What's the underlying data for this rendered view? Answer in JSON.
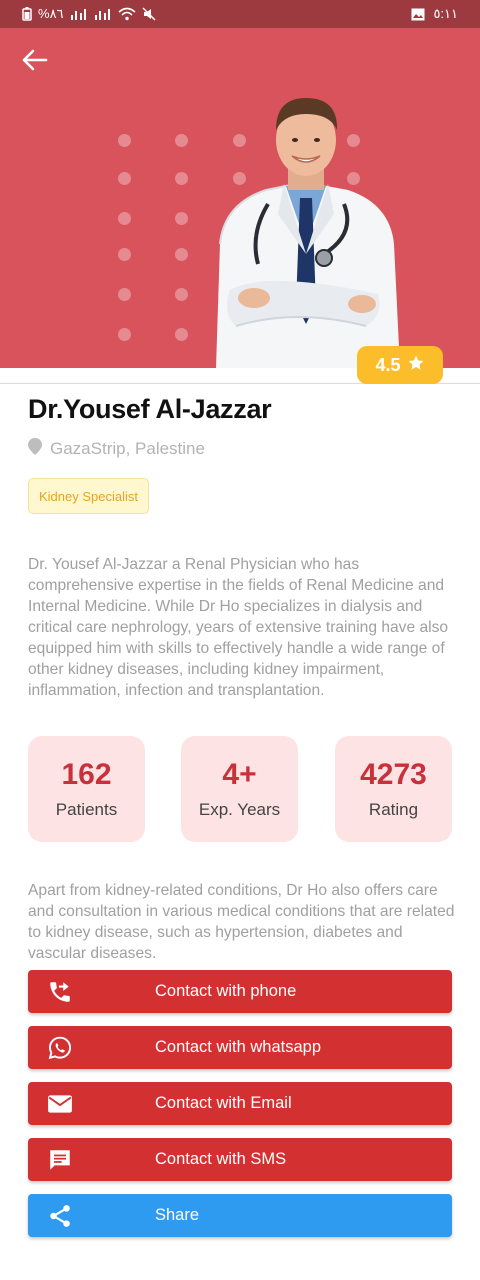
{
  "status_bar": {
    "battery": "%٨٦",
    "time": "٥:١١",
    "icons": [
      "battery-icon",
      "signal-icon",
      "signal-icon",
      "wifi-icon",
      "mute-icon",
      "image-icon"
    ]
  },
  "header": {
    "back_icon": "arrow-left-icon"
  },
  "doctor": {
    "rating": "4.5",
    "name": "Dr.Yousef Al-Jazzar",
    "location": "GazaStrip, Palestine",
    "specialty": "Kidney Specialist",
    "bio": "Dr. Yousef Al-Jazzar a Renal Physician who has comprehensive expertise in the fields of Renal Medicine and Internal Medicine. While Dr Ho specializes in dialysis and critical care nephrology, years of extensive training have also equipped him with skills to effectively handle a wide range of other kidney diseases, including kidney impairment, inflammation, infection and transplantation.",
    "extra": "Apart from kidney-related conditions, Dr Ho also offers care and consultation in various medical conditions that are related to kidney disease, such as hypertension, diabetes and vascular diseases."
  },
  "stats": [
    {
      "value": "162",
      "label": "Patients"
    },
    {
      "value": "4+",
      "label": "Exp. Years"
    },
    {
      "value": "4273",
      "label": "Rating"
    }
  ],
  "actions": [
    {
      "label": "Contact with phone",
      "icon": "phone-forward-icon"
    },
    {
      "label": "Contact with whatsapp",
      "icon": "whatsapp-icon"
    },
    {
      "label": "Contact with Email",
      "icon": "email-icon"
    },
    {
      "label": "Contact with SMS",
      "icon": "sms-icon"
    },
    {
      "label": "Share",
      "icon": "share-icon"
    }
  ],
  "colors": {
    "hero": "#d9535c",
    "status_bar": "#9c3a40",
    "rating_badge": "#fbbd29",
    "stat_card": "#fde3e3",
    "stat_value": "#c8313b",
    "contact_button": "#d33131",
    "share_button": "#2f9bf0"
  }
}
